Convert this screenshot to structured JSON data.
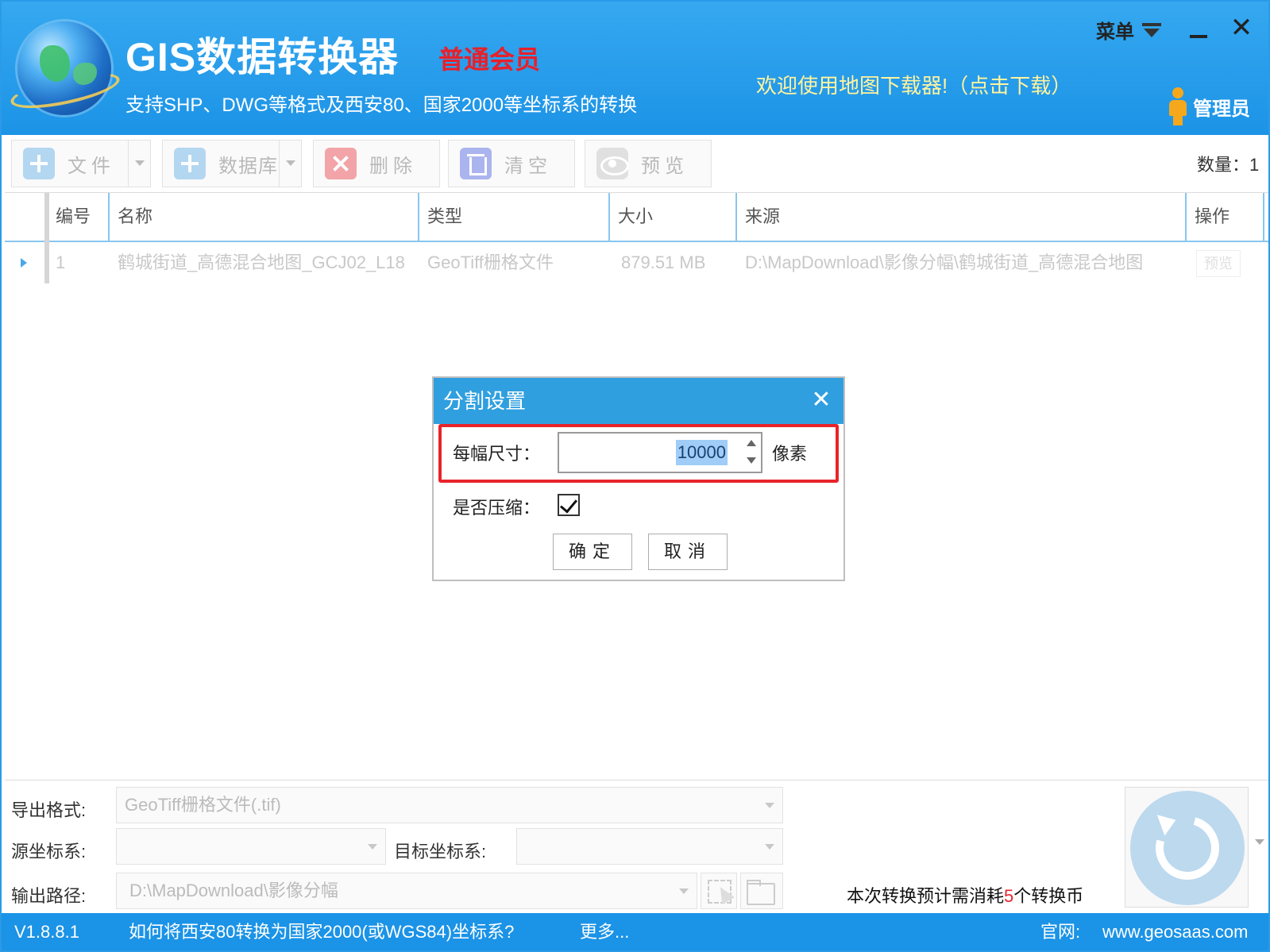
{
  "header": {
    "app_title": "GIS数据转换器",
    "member_level": "普通会员",
    "subtitle": "支持SHP、DWG等格式及西安80、国家2000等坐标系的转换",
    "welcome_link": "欢迎使用地图下载器!（点击下载）",
    "menu_label": "菜单",
    "close_glyph": "✕",
    "admin_label": "管理员",
    "colors": {
      "header_bg": "#1c93e6",
      "member_red": "#e8202a",
      "welcome_yellow": "#fff3a0"
    }
  },
  "toolbar": {
    "file_label": "文件",
    "database_label": "数据库",
    "delete_label": "删除",
    "clear_label": "清空",
    "preview_label": "预览",
    "count_label": "数量：1"
  },
  "table": {
    "columns": [
      "编号",
      "名称",
      "类型",
      "大小",
      "来源",
      "操作"
    ],
    "rows": [
      {
        "id": "1",
        "name": "鹤城街道_高德混合地图_GCJ02_L18",
        "type": "GeoTiff栅格文件",
        "size": "879.51 MB",
        "source": "D:\\MapDownload\\影像分幅\\鹤城街道_高德混合地图",
        "action": "预览"
      }
    ]
  },
  "dialog": {
    "title": "分割设置",
    "close_glyph": "✕",
    "size_label": "每幅尺寸：",
    "size_value": "10000",
    "unit_label": "像素",
    "compress_label": "是否压缩：",
    "compress_checked": true,
    "ok_label": "确定",
    "cancel_label": "取消"
  },
  "settings": {
    "export_format_label": "导出格式:",
    "export_format_value": "GeoTiff栅格文件(.tif)",
    "source_crs_label": "源坐标系:",
    "source_crs_value": "",
    "target_crs_label": "目标坐标系:",
    "target_crs_value": "",
    "output_path_label": "输出路径:",
    "output_path_value": "D:\\MapDownload\\影像分幅",
    "cost_prefix": "本次转换预计需消耗",
    "cost_amount": "5",
    "cost_suffix": "个转换币"
  },
  "statusbar": {
    "version": "V1.8.8.1",
    "help_link": "如何将西安80转换为国家2000(或WGS84)坐标系?",
    "more_link": "更多...",
    "website_label": "官网:",
    "website_url": "www.geosaas.com"
  }
}
